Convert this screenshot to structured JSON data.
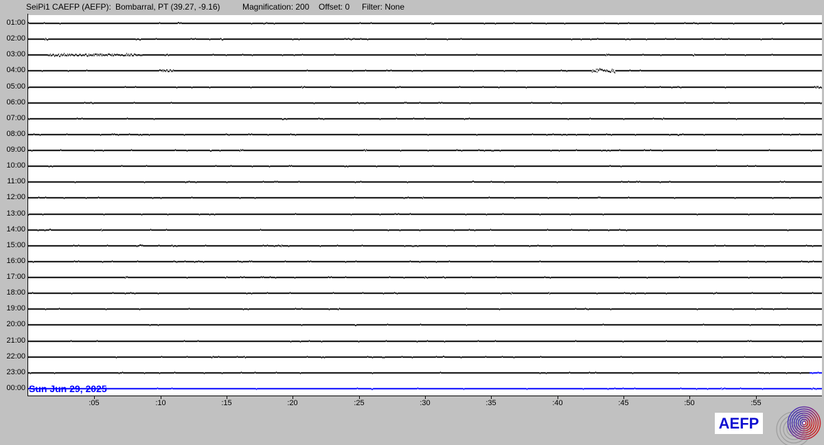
{
  "header": {
    "station": "SeiPi1 CAEFP (AEFP):",
    "location": "Bombarral, PT (39.27, -9.16)",
    "magnification": "Magnification: 200",
    "offset": "Offset: 0",
    "filter": "Filter: None"
  },
  "date_label": "Sun Jun 29, 2025",
  "branding": {
    "logo_text": "AEFP"
  },
  "colors": {
    "background": "#c1c1c1",
    "plot_background": "#ffffff",
    "trace_black": "#000000",
    "trace_blue": "#0000ff",
    "date_blue": "#0000ff",
    "logo_text_blue": "#0f0fd0",
    "logo_gray": "#9e9e9e",
    "logo_gradient_start": "#3535c0",
    "logo_gradient_end": "#cf1f1f"
  },
  "chart_data": {
    "type": "helicorder",
    "title": "SeiPi1 CAEFP (AEFP): Bombarral, PT (39.27, -9.16)",
    "station": "SeiPi1 CAEFP (AEFP)",
    "location": "Bombarral, PT (39.27, -9.16)",
    "magnification": 200,
    "offset": 0,
    "filter": "None",
    "date": "Sun Jun 29, 2025",
    "x_axis": {
      "unit": "minutes",
      "range": [
        0,
        60
      ],
      "tick_interval": 5,
      "tick_labels": [
        ":05",
        ":10",
        ":15",
        ":20",
        ":25",
        ":30",
        ":35",
        ":40",
        ":45",
        ":50",
        ":55"
      ]
    },
    "y_axis": {
      "unit": "hour of day",
      "tick_labels": [
        "01:00",
        "02:00",
        "03:00",
        "04:00",
        "05:00",
        "06:00",
        "07:00",
        "08:00",
        "09:00",
        "10:00",
        "11:00",
        "12:00",
        "13:00",
        "14:00",
        "15:00",
        "16:00",
        "17:00",
        "18:00",
        "19:00",
        "20:00",
        "21:00",
        "22:00",
        "23:00",
        "00:00"
      ]
    },
    "grid": false,
    "noise_seed": 987654,
    "baseline_noise_probability": 0.025,
    "traces": [
      {
        "hour": "01:00",
        "color": "black",
        "events": [
          {
            "start_min": 11.3,
            "end_min": 11.6,
            "amp": 1
          },
          {
            "start_min": 30.4,
            "end_min": 30.7,
            "amp": 1
          },
          {
            "start_min": 56.9,
            "end_min": 57.2,
            "amp": 1
          }
        ]
      },
      {
        "hour": "02:00",
        "color": "black",
        "events": [
          {
            "start_min": 1.2,
            "end_min": 1.5,
            "amp": 1
          },
          {
            "start_min": 8.2,
            "end_min": 8.5,
            "amp": 1
          },
          {
            "start_min": 14.4,
            "end_min": 14.7,
            "amp": 1
          }
        ]
      },
      {
        "hour": "03:00",
        "color": "black",
        "events": [
          {
            "start_min": 1.5,
            "end_min": 8.6,
            "amp": 1.6
          },
          {
            "start_min": 10.3,
            "end_min": 10.6,
            "amp": 1
          },
          {
            "start_min": 43.5,
            "end_min": 43.8,
            "amp": 1
          },
          {
            "start_min": 50.2,
            "end_min": 50.5,
            "amp": 1
          },
          {
            "start_min": 56.2,
            "end_min": 56.5,
            "amp": 1
          }
        ]
      },
      {
        "hour": "04:00",
        "color": "black",
        "events": [
          {
            "start_min": 9.8,
            "end_min": 11.0,
            "amp": 1.4
          },
          {
            "start_min": 42.6,
            "end_min": 44.4,
            "amp": 3
          }
        ]
      },
      {
        "hour": "05:00",
        "color": "black",
        "events": [
          {
            "start_min": 20.6,
            "end_min": 20.9,
            "amp": 1
          },
          {
            "start_min": 59.4,
            "end_min": 59.8,
            "amp": 1.2
          }
        ]
      },
      {
        "hour": "06:00",
        "color": "black",
        "events": []
      },
      {
        "hour": "07:00",
        "color": "black",
        "events": [
          {
            "start_min": 19.1,
            "end_min": 19.4,
            "amp": 1
          }
        ]
      },
      {
        "hour": "08:00",
        "color": "black",
        "events": [
          {
            "start_min": 14.9,
            "end_min": 15.2,
            "amp": 1
          }
        ]
      },
      {
        "hour": "09:00",
        "color": "black",
        "events": []
      },
      {
        "hour": "10:00",
        "color": "black",
        "events": []
      },
      {
        "hour": "11:00",
        "color": "black",
        "events": []
      },
      {
        "hour": "12:00",
        "color": "black",
        "events": [
          {
            "start_min": 24.5,
            "end_min": 24.8,
            "amp": 1
          }
        ]
      },
      {
        "hour": "13:00",
        "color": "black",
        "events": []
      },
      {
        "hour": "14:00",
        "color": "black",
        "events": []
      },
      {
        "hour": "15:00",
        "color": "black",
        "events": [
          {
            "start_min": 8.4,
            "end_min": 8.7,
            "amp": 1
          },
          {
            "start_min": 10.8,
            "end_min": 11.1,
            "amp": 1
          }
        ]
      },
      {
        "hour": "16:00",
        "color": "black",
        "events": []
      },
      {
        "hour": "17:00",
        "color": "black",
        "events": [
          {
            "start_min": 7.3,
            "end_min": 7.6,
            "amp": 1
          },
          {
            "start_min": 29.9,
            "end_min": 30.2,
            "amp": 1
          }
        ]
      },
      {
        "hour": "18:00",
        "color": "black",
        "events": []
      },
      {
        "hour": "19:00",
        "color": "black",
        "events": []
      },
      {
        "hour": "20:00",
        "color": "black",
        "events": []
      },
      {
        "hour": "21:00",
        "color": "black",
        "events": []
      },
      {
        "hour": "22:00",
        "color": "black",
        "events": []
      },
      {
        "hour": "23:00",
        "color": "black",
        "blue_tail_from_min": 59.05,
        "events": []
      },
      {
        "hour": "00:00",
        "color": "blue",
        "events": []
      }
    ]
  }
}
